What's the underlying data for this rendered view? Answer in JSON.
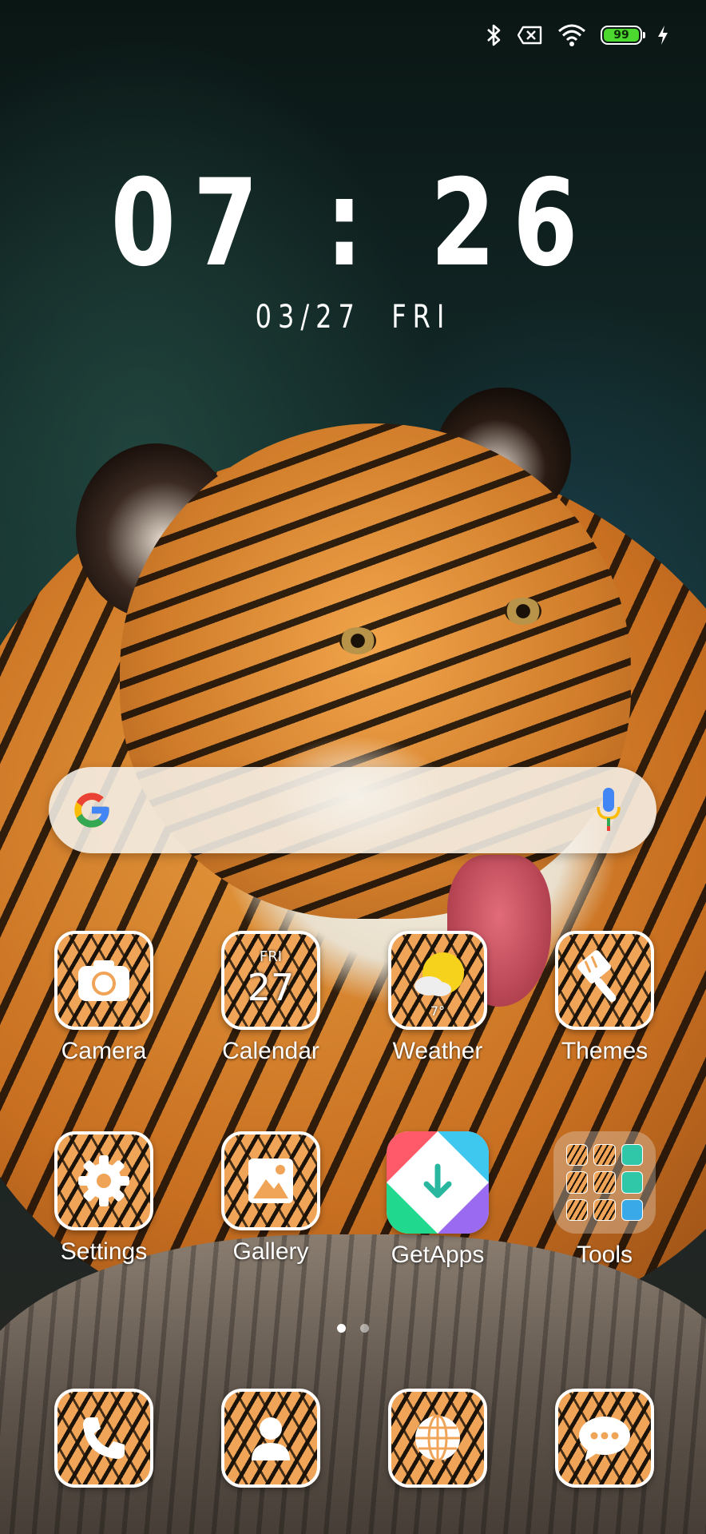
{
  "status_bar": {
    "icons": [
      "bluetooth-icon",
      "no-sim-icon",
      "wifi-icon",
      "battery-icon",
      "charging-icon"
    ],
    "battery_level": "99",
    "battery_color": "#4cd82e"
  },
  "clock": {
    "time": "07 : 26",
    "date": "03/27",
    "weekday": "FRI"
  },
  "search_bar": {
    "icons": [
      "google-logo-icon",
      "microphone-icon"
    ]
  },
  "apps_row1": [
    {
      "label": "Camera",
      "icon": "camera-icon"
    },
    {
      "label": "Calendar",
      "icon": "calendar-icon",
      "day": "FRI",
      "date": "27"
    },
    {
      "label": "Weather",
      "icon": "weather-icon",
      "temp": "7°"
    },
    {
      "label": "Themes",
      "icon": "paintbrush-icon"
    }
  ],
  "apps_row2": [
    {
      "label": "Settings",
      "icon": "gear-icon"
    },
    {
      "label": "Gallery",
      "icon": "image-icon"
    },
    {
      "label": "GetApps",
      "icon": "getapps-icon"
    },
    {
      "label": "Tools",
      "icon": "folder-icon"
    }
  ],
  "page_indicator": {
    "pages": 2,
    "current": 1
  },
  "dock": [
    {
      "icon": "phone-icon"
    },
    {
      "icon": "contacts-icon"
    },
    {
      "icon": "browser-icon"
    },
    {
      "icon": "messages-icon"
    }
  ],
  "colors": {
    "tiger_icon_orange": "#f0a457",
    "tiger_stripe": "#1b1208",
    "search_bg": "#f5f0e8",
    "google_blue": "#4285F4",
    "google_red": "#EA4335",
    "google_yellow": "#FBBC05",
    "google_green": "#34A853"
  }
}
